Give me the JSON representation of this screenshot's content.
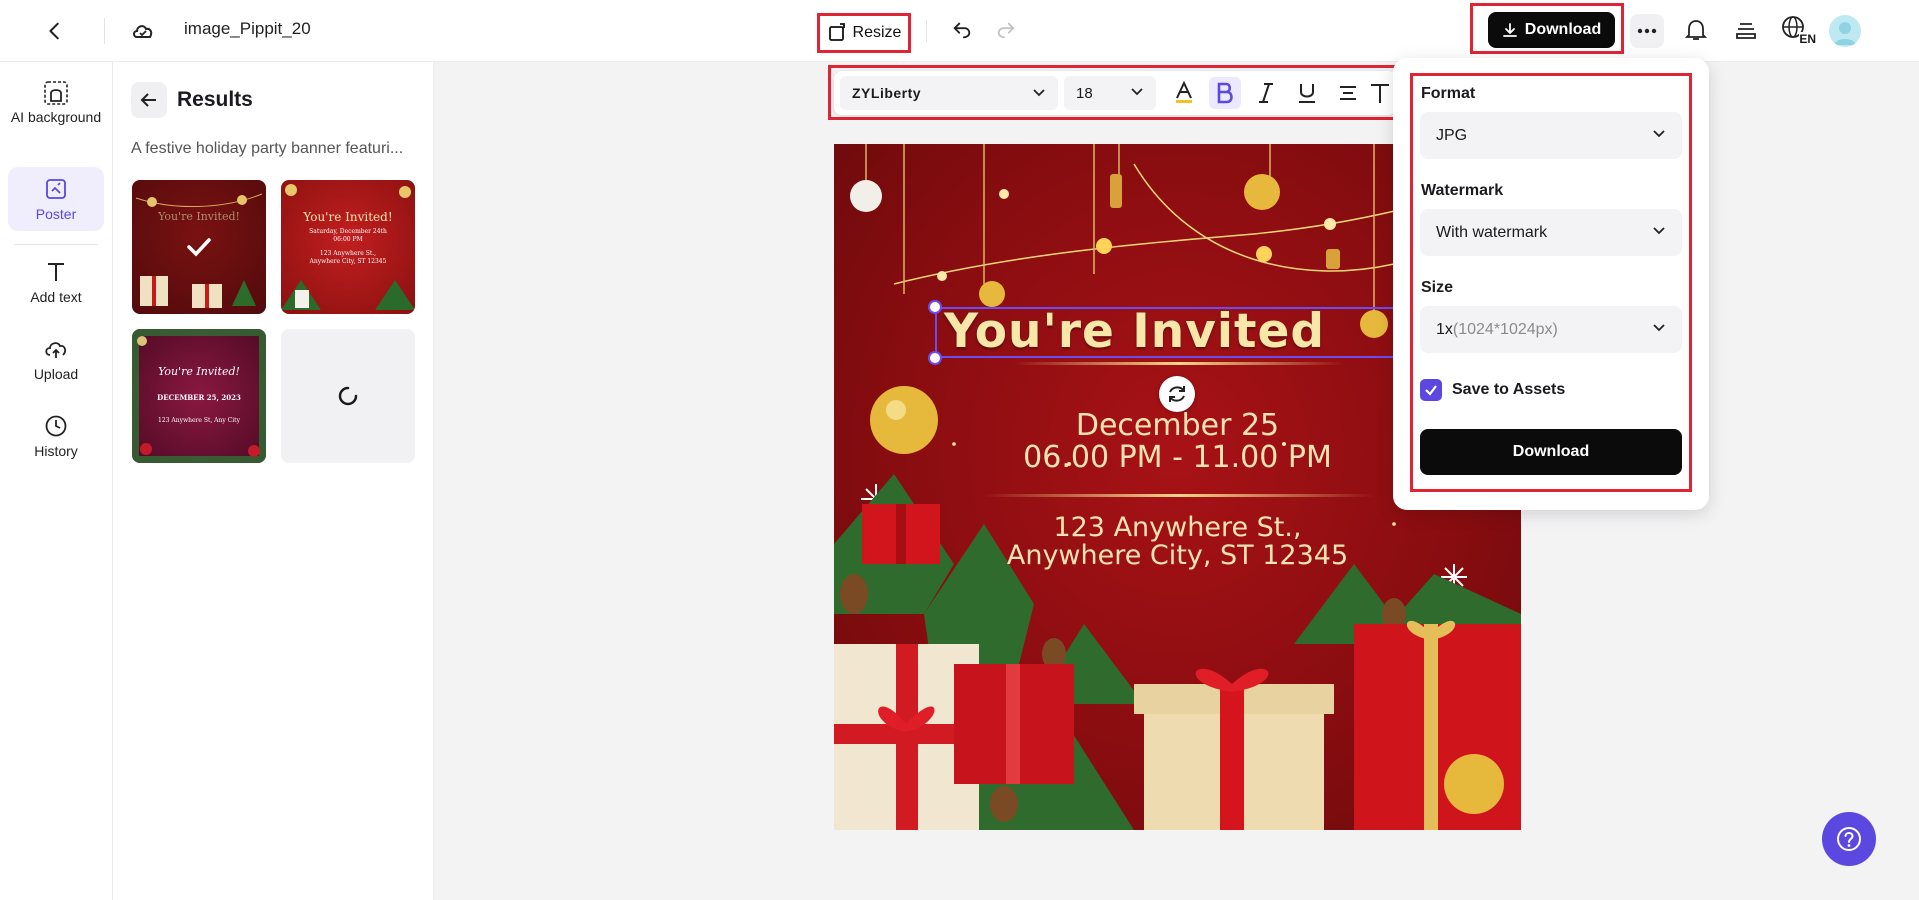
{
  "header": {
    "doc_title": "image_Pippit_20",
    "resize_label": "Resize",
    "download_label": "Download",
    "language": "EN"
  },
  "rail": {
    "items": [
      {
        "label": "AI background",
        "icon": "ai-background-icon"
      },
      {
        "label": "Poster",
        "icon": "poster-icon",
        "active": true
      },
      {
        "label": "Add text",
        "icon": "text-icon"
      },
      {
        "label": "Upload",
        "icon": "upload-icon"
      },
      {
        "label": "History",
        "icon": "history-icon"
      }
    ]
  },
  "panel": {
    "title": "Results",
    "prompt": "A festive holiday party banner featuri...",
    "thumbs": [
      {
        "title": "You're Invited!",
        "selected": true
      },
      {
        "title": "You're Invited!",
        "lines": [
          "Saturday, December 24th",
          "06:00 PM",
          "123 Anywhere St.,",
          "Anywhere City, ST 12345"
        ]
      },
      {
        "title": "You're Invited!",
        "lines": [
          "DECEMBER 25, 2023",
          "123 Anywhere St, Any City"
        ]
      },
      {
        "loading": true
      }
    ]
  },
  "toolbar": {
    "font": "ZYLiberty",
    "size": "18"
  },
  "poster": {
    "headline": "You're Invited",
    "date": "December 25",
    "time": "06.00 PM - 11.00 PM",
    "address1": "123 Anywhere St.,",
    "address2": "Anywhere City, ST 12345"
  },
  "download_menu": {
    "format_label": "Format",
    "format_value": "JPG",
    "watermark_label": "Watermark",
    "watermark_value": "With watermark",
    "size_label": "Size",
    "size_value": "1x",
    "size_detail": "(1024*1024px)",
    "save_to_assets_label": "Save to Assets",
    "save_to_assets": true,
    "confirm_label": "Download"
  },
  "colors": {
    "accent": "#5a48e0",
    "highlight_frame": "#e02433",
    "poster_red": "#8a0d10",
    "poster_gold": "#f6e2b4"
  }
}
